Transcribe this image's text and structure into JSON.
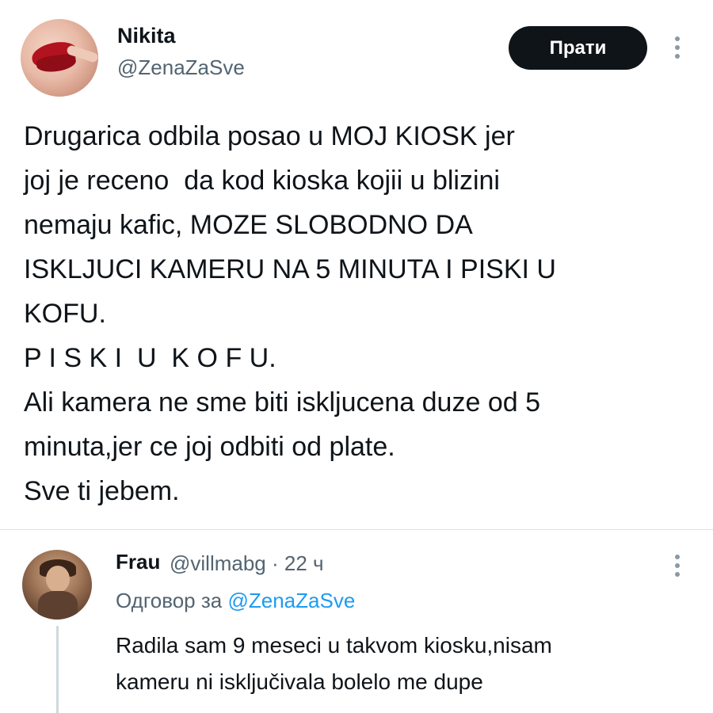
{
  "tweet": {
    "author_name": "Nikita",
    "author_handle": "@ZenaZaSve",
    "follow_label": "Прати",
    "body": "Drugarica odbila posao u MOJ KIOSK jer\njoj je receno  da kod kioska kojii u blizini\nnemaju kafic, MOZE SLOBODNO DA\nISKLJUCI KAMERU NA 5 MINUTA I PISKI U\nKOFU.\nP I S K I  U  K O F U.\nAli kamera ne sme biti iskljucena duze od 5\nminuta,jer ce joj odbiti od plate.\nSve ti jebem."
  },
  "reply": {
    "author_name": "Frau",
    "meta": "@villmabg · 22 ч",
    "replying_prefix": "Одговор за",
    "replying_mention": "@ZenaZaSve",
    "body": "Radila sam 9 meseci u takvom kiosku,nisam\nkameru ni isključivala bolelo me dupe"
  },
  "icons": {
    "main_avatar": "avatar-lips-photo",
    "reply_avatar": "avatar-child-photo",
    "more": "more-vertical-icon"
  },
  "colors": {
    "text": "#0f1419",
    "muted": "#536471",
    "link": "#1d9bf0",
    "follow_bg": "#0f1419"
  }
}
